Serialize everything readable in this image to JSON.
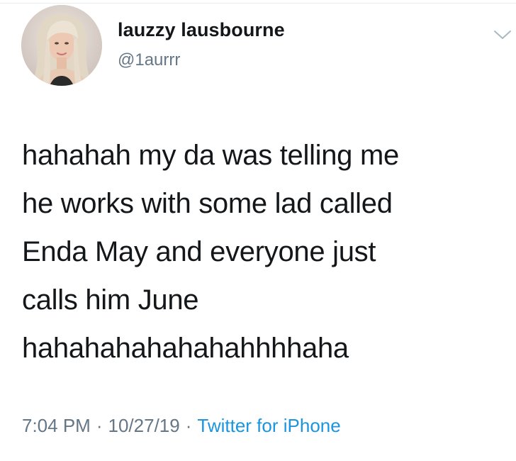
{
  "tweet": {
    "display_name": "lauzzy lausbourne",
    "handle": "@1aurrr",
    "text": "hahahah my da was telling me\nhe works with some lad called\nEnda May and everyone just\ncalls him June\nhahahahahahahahhhhaha",
    "time": "7:04 PM",
    "date": "10/27/19",
    "source": "Twitter for iPhone",
    "separator": "·"
  },
  "icons": {
    "avatar": "profile-photo",
    "menu": "chevron-down-icon"
  },
  "colors": {
    "text": "#14171a",
    "secondary": "#657786",
    "link": "#1b95e0",
    "border": "#e6ecf0"
  }
}
